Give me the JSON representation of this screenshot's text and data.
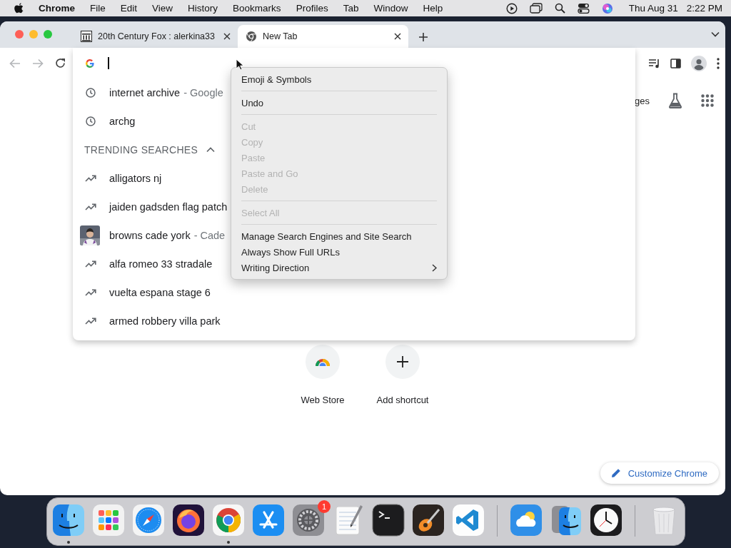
{
  "menubar": {
    "app": "Chrome",
    "menus": [
      "File",
      "Edit",
      "View",
      "History",
      "Bookmarks",
      "Profiles",
      "Tab",
      "Window",
      "Help"
    ],
    "date": "Thu Aug 31",
    "time": "2:22 PM"
  },
  "tabs": [
    {
      "kind": "site",
      "title": "20th Century Fox : alerkina33",
      "selected": false
    },
    {
      "kind": "newtab",
      "title": "New Tab",
      "selected": true
    }
  ],
  "toolbar": {
    "back": {
      "disabled": true
    },
    "forward": {
      "disabled": true
    }
  },
  "omnibox": {
    "suggestions": [
      {
        "kind": "history",
        "text": "internet archive",
        "detail": "- Google"
      },
      {
        "kind": "history",
        "text": "archg"
      }
    ],
    "trending": {
      "title": "TRENDING SEARCHES",
      "expanded": true,
      "items": [
        {
          "kind": "trend",
          "text": "alligators nj"
        },
        {
          "kind": "trend",
          "text": "jaiden gadsden flag patch"
        },
        {
          "kind": "picture",
          "text": "browns cade york",
          "detail": "- Cade"
        },
        {
          "kind": "trend",
          "text": "alfa romeo 33 stradale"
        },
        {
          "kind": "trend",
          "text": "vuelta espana stage 6"
        },
        {
          "kind": "trend",
          "text": "armed robbery villa park"
        }
      ]
    }
  },
  "context_menu": {
    "groups": [
      [
        {
          "label": "Emoji & Symbols",
          "disabled": false,
          "submenu": false
        }
      ],
      [
        {
          "label": "Undo",
          "disabled": false,
          "submenu": false
        }
      ],
      [
        {
          "label": "Cut",
          "disabled": true,
          "submenu": false
        },
        {
          "label": "Copy",
          "disabled": true,
          "submenu": false
        },
        {
          "label": "Paste",
          "disabled": true,
          "submenu": false
        },
        {
          "label": "Paste and Go",
          "disabled": true,
          "submenu": false
        },
        {
          "label": "Delete",
          "disabled": true,
          "submenu": false
        }
      ],
      [
        {
          "label": "Select All",
          "disabled": true,
          "submenu": false
        }
      ],
      [
        {
          "label": "Manage Search Engines and Site Search",
          "disabled": false,
          "submenu": false
        },
        {
          "label": "Always Show Full URLs",
          "disabled": false,
          "submenu": false
        },
        {
          "label": "Writing Direction",
          "disabled": false,
          "submenu": true
        }
      ]
    ]
  },
  "page": {
    "header_link": "ges",
    "shortcuts": [
      {
        "kind": "webstore",
        "label": "Web Store"
      },
      {
        "kind": "add",
        "label": "Add shortcut"
      }
    ],
    "customize": "Customize Chrome"
  },
  "dock": {
    "items": [
      {
        "kind": "finder",
        "running": true
      },
      {
        "kind": "launchpad",
        "running": false
      },
      {
        "kind": "safari",
        "running": false
      },
      {
        "kind": "firefox",
        "running": false
      },
      {
        "kind": "chrome",
        "running": true
      },
      {
        "kind": "appstore",
        "running": false
      },
      {
        "kind": "settings",
        "running": false,
        "badge": "1"
      },
      {
        "kind": "textedit",
        "running": false
      },
      {
        "kind": "terminal",
        "running": false
      },
      {
        "kind": "garageband",
        "running": false
      },
      {
        "kind": "vscode",
        "running": false
      },
      {
        "kind": "separator"
      },
      {
        "kind": "weather",
        "running": false
      },
      {
        "kind": "migration",
        "running": false
      },
      {
        "kind": "clock",
        "running": false
      },
      {
        "kind": "separator"
      },
      {
        "kind": "trash",
        "running": false
      }
    ]
  }
}
